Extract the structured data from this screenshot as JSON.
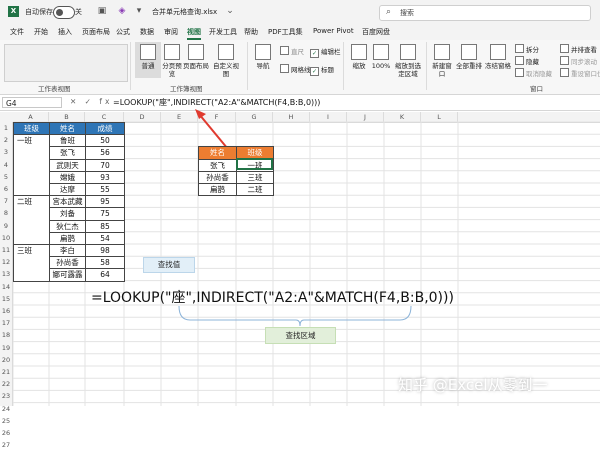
{
  "titlebar": {
    "autosave_label": "自动保存",
    "toggle_text": "关",
    "filename": "合并单元格查询.xlsx",
    "search_placeholder": "搜索"
  },
  "menu": {
    "tabs": [
      "文件",
      "开始",
      "插入",
      "页面布局",
      "公式",
      "数据",
      "审阅",
      "视图",
      "开发工具",
      "帮助",
      "PDF工具集",
      "Power Pivot",
      "百度网盘"
    ],
    "active": "视图"
  },
  "ribbon": {
    "buttons": {
      "normal": "普通",
      "page_break": "分页预览",
      "page_layout": "页面布局",
      "custom_view": "自定义视图",
      "navigation": "导航",
      "zoom": "缩放",
      "zoom100": "100%",
      "zoom_sel": "缩放到选定区域",
      "new_window": "新建窗口",
      "arrange_all": "全部重排",
      "freeze": "冻结窗格",
      "split": "拆分",
      "hide": "隐藏",
      "unhide": "取消隐藏",
      "side_by_side": "并排查看",
      "sync_scroll": "同步滚动",
      "reset_pos": "重设窗口位置"
    },
    "checks": {
      "ruler": "直尺",
      "formula_bar": "编辑栏",
      "gridlines": "网格线",
      "headings": "标题"
    },
    "groups": {
      "sheet_view": "工作表视图",
      "workbook_view": "工作簿视图",
      "window": "窗口"
    }
  },
  "formula_bar": {
    "name_box": "G4",
    "fx_icons": "✕ ✓ fx",
    "formula": "=LOOKUP(\"座\",INDIRECT(\"A2:A\"&MATCH(F4,B:B,0)))"
  },
  "columns": [
    "A",
    "B",
    "C",
    "D",
    "E",
    "F",
    "G",
    "H",
    "I",
    "J",
    "K",
    "L"
  ],
  "rows": [
    "1",
    "2",
    "3",
    "4",
    "5",
    "6",
    "7",
    "8",
    "9",
    "10",
    "11",
    "12",
    "13",
    "14",
    "15",
    "16",
    "17",
    "18",
    "19",
    "20",
    "21",
    "22",
    "23",
    "24",
    "25",
    "26",
    "27"
  ],
  "table1": {
    "headers": [
      "班级",
      "姓名",
      "成绩"
    ],
    "classes": [
      "一班",
      "二班",
      "三班"
    ],
    "names": [
      "鲁班",
      "张飞",
      "武则天",
      "嫦娥",
      "达摩",
      "宫本武藏",
      "刘备",
      "狄仁杰",
      "扁鹊",
      "李白",
      "孙尚香",
      "娜可露露"
    ],
    "scores": [
      "50",
      "56",
      "70",
      "93",
      "55",
      "95",
      "75",
      "85",
      "54",
      "98",
      "58",
      "64"
    ]
  },
  "table2": {
    "headers": [
      "姓名",
      "班级"
    ],
    "rows": [
      [
        "张飞",
        "一班"
      ],
      [
        "孙尚香",
        "三班"
      ],
      [
        "扁鹊",
        "二班"
      ]
    ]
  },
  "annotations": {
    "lookup_value": "查找值",
    "big_formula": "=LOOKUP(\"座\",INDIRECT(\"A2:A\"&MATCH(F4,B:B,0)))",
    "lookup_range": "查找区域"
  },
  "watermark": "知乎 @Excel从零到一",
  "colors": {
    "excel_green": "#217346",
    "table_header_blue": "#2e75b6",
    "table_header_orange": "#ed7d31",
    "arrow_red": "#e03a2f",
    "brace_blue": "#8db4d9"
  }
}
